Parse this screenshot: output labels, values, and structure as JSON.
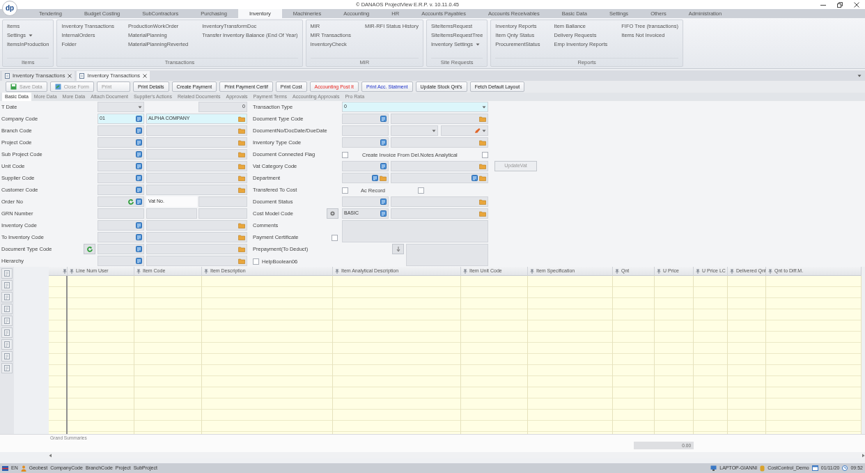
{
  "window": {
    "logo": "dp",
    "title": "© DANAOS ProjectView E.R.P. v. 10.11.0.45"
  },
  "ribbon_tabs": [
    {
      "label": "Tendering",
      "selected": false
    },
    {
      "label": "Budget Costing",
      "selected": false
    },
    {
      "label": "SubContractors",
      "selected": false
    },
    {
      "label": "Purchasing",
      "selected": false
    },
    {
      "label": "Inventory",
      "selected": true
    },
    {
      "label": "Machineries",
      "selected": false
    },
    {
      "label": "Accounting",
      "selected": false
    },
    {
      "label": "HR",
      "selected": false
    },
    {
      "label": "Accounts Payables",
      "selected": false
    },
    {
      "label": "Accounts Receivables",
      "selected": false
    },
    {
      "label": "Basic Data",
      "selected": false
    },
    {
      "label": "Settings",
      "selected": false
    },
    {
      "label": "Others",
      "selected": false
    },
    {
      "label": "Administration",
      "selected": false
    }
  ],
  "ribbon_groups": [
    {
      "title": "Items",
      "columns": [
        [
          {
            "label": "Items",
            "dropdown": false
          },
          {
            "label": "Settings",
            "dropdown": true
          },
          {
            "label": "ItemsInProduction",
            "dropdown": false
          }
        ]
      ]
    },
    {
      "title": "Transactions",
      "columns": [
        [
          {
            "label": "Inventory Transactions",
            "dropdown": false
          },
          {
            "label": "InternalOrders",
            "dropdown": false
          },
          {
            "label": "Folder",
            "dropdown": false
          }
        ],
        [
          {
            "label": "ProductionWorkOrder",
            "dropdown": false
          },
          {
            "label": "MaterialPlanning",
            "dropdown": false
          },
          {
            "label": "MaterialPlanningReverted",
            "dropdown": false
          }
        ],
        [
          {
            "label": "InventoryTransformDoc",
            "dropdown": false
          },
          {
            "label": "Transfer Inventory Balance (End Of Year)",
            "dropdown": false
          }
        ]
      ]
    },
    {
      "title": "MIR",
      "columns": [
        [
          {
            "label": "MIR",
            "dropdown": false
          },
          {
            "label": "MIR Transactions",
            "dropdown": false
          },
          {
            "label": "InventoryCheck",
            "dropdown": false
          }
        ],
        [
          {
            "label": "MIR-RFI Status History",
            "dropdown": false
          }
        ]
      ]
    },
    {
      "title": "Site Requests",
      "columns": [
        [
          {
            "label": "SiteItemsRequest",
            "dropdown": false
          },
          {
            "label": "SiteItemsRequestTree",
            "dropdown": false
          },
          {
            "label": "Inventory Settings",
            "dropdown": true
          }
        ]
      ]
    },
    {
      "title": "Reports",
      "columns": [
        [
          {
            "label": "Inventory Reports",
            "dropdown": false
          },
          {
            "label": "Item Qnty Status",
            "dropdown": false
          },
          {
            "label": "ProcurementStatus",
            "dropdown": false
          }
        ],
        [
          {
            "label": "Item Ballance",
            "dropdown": false
          },
          {
            "label": "Delivery Requests",
            "dropdown": false
          },
          {
            "label": "Emp Inventory Reports",
            "dropdown": false
          }
        ],
        [
          {
            "label": "FIFO Tree (transactions)",
            "dropdown": false
          },
          {
            "label": "Items Not Invoiced",
            "dropdown": false
          }
        ]
      ]
    }
  ],
  "doc_tabs": [
    {
      "label": "Inventory Transactions",
      "selected": false
    },
    {
      "label": "Inventory Transactions",
      "selected": true
    }
  ],
  "toolbar": [
    {
      "label": "Save Data",
      "kind": "save",
      "disabled": true
    },
    {
      "label": "Close Form",
      "kind": "close",
      "disabled": true
    },
    {
      "label": "Print",
      "kind": "plain",
      "disabled": true
    },
    {
      "label": "Print Details",
      "kind": "plain",
      "disabled": false
    },
    {
      "label": "Create Payment",
      "kind": "plain",
      "disabled": false
    },
    {
      "label": "Print Payment Certif",
      "kind": "plain",
      "disabled": false
    },
    {
      "label": "Print Cost",
      "kind": "plain",
      "disabled": false
    },
    {
      "label": "Accounting Post It",
      "kind": "alert",
      "disabled": false
    },
    {
      "label": "Print Acc. Statment",
      "kind": "accent",
      "disabled": false
    },
    {
      "label": "Update Stock Qnt's",
      "kind": "plain",
      "disabled": false
    },
    {
      "label": "Fetch Default Layout",
      "kind": "plain",
      "disabled": false
    }
  ],
  "form_tabs": [
    {
      "label": "Basic Data",
      "selected": true
    },
    {
      "label": "More Data",
      "selected": false
    },
    {
      "label": "More Data",
      "selected": false
    },
    {
      "label": "Attach Document",
      "selected": false
    },
    {
      "label": "Supplier's Actions",
      "selected": false
    },
    {
      "label": "Related Documents",
      "selected": false
    },
    {
      "label": "Approvals",
      "selected": false
    },
    {
      "label": "Payment Terms",
      "selected": false
    },
    {
      "label": "Accounting Approvals",
      "selected": false
    },
    {
      "label": "Pro Rata",
      "selected": false
    }
  ],
  "left_fields": [
    {
      "label": "T Date",
      "kind": "date",
      "number": "0"
    },
    {
      "label": "Company Code",
      "kind": "lookup",
      "code": "01",
      "name": "ALPHA COMPANY",
      "active": true
    },
    {
      "label": "Branch Code",
      "kind": "lookup",
      "active": false
    },
    {
      "label": "Project Code",
      "kind": "lookup",
      "active": false
    },
    {
      "label": "Sub Project Code",
      "kind": "lookup",
      "active": false
    },
    {
      "label": "Unit Code",
      "kind": "lookup",
      "active": false
    },
    {
      "label": "Supplier Code",
      "kind": "lookup",
      "active": false
    },
    {
      "label": "Customer Code",
      "kind": "lookup",
      "active": false
    },
    {
      "label": "Order No",
      "kind": "order",
      "vat_label": "Vat No."
    },
    {
      "label": "GRN Number",
      "kind": "plain3"
    },
    {
      "label": "Inventory Code",
      "kind": "lookup",
      "active": false
    },
    {
      "label": "To Inventory Code",
      "kind": "lookup",
      "active": false
    },
    {
      "label": "Document Type Code",
      "kind": "lookup_refresh",
      "active": false
    },
    {
      "label": "Hierarchy",
      "kind": "lookup",
      "active": false
    }
  ],
  "right_fields": [
    {
      "label": "Transaction Type",
      "kind": "combo",
      "value": "0"
    },
    {
      "label": "Document Type Code",
      "kind": "lookup"
    },
    {
      "label": "DocumentNo/DocDate/DueDate",
      "kind": "docno"
    },
    {
      "label": "Inventory Type Code",
      "kind": "lookup"
    },
    {
      "label": "Document Connected Flag",
      "kind": "flag",
      "checked": false,
      "inner_label": "Create Invoice From Del.Notes Analytical",
      "inner_checked": false
    },
    {
      "label": "Vat Category Code",
      "kind": "lookup",
      "action": "UpdateVat"
    },
    {
      "label": "Department",
      "kind": "lookup_double"
    },
    {
      "label": "Transfered To Cost",
      "kind": "flag",
      "checked": false,
      "inner_label": "Ac Record",
      "inner_checked": false
    },
    {
      "label": "Document Status",
      "kind": "lookup"
    },
    {
      "label": "Cost Model Code",
      "kind": "costmodel",
      "code": "BASIC"
    },
    {
      "label": "Comments",
      "kind": "memo"
    },
    {
      "label": "Payment Certificate",
      "kind": "payment",
      "checked": false
    },
    {
      "label": "Prepayment(To Deduct)",
      "kind": "prepay"
    },
    {
      "label": "HelpBoolean06",
      "kind": "check_label",
      "checked": false
    }
  ],
  "grid": {
    "columns": [
      "Line Num User",
      "Item Code",
      "Item Description",
      "Item Analytical Description",
      "Item Unit Code",
      "Item Specification",
      "Qnt",
      "U Price",
      "U Price LC",
      "Delivered Qnt",
      "Qnt to Diff.M."
    ],
    "summary_title": "Grand Summaries",
    "summary_value": "0.00"
  },
  "status_bar": {
    "left": [
      "EN",
      "Geobest",
      "CompanyCode",
      "BranchCode",
      "Project",
      "SubProject"
    ],
    "right": [
      "LAPTOP-GIANNI",
      "CostControl_Demo",
      "01/11/20",
      "09:52"
    ]
  }
}
